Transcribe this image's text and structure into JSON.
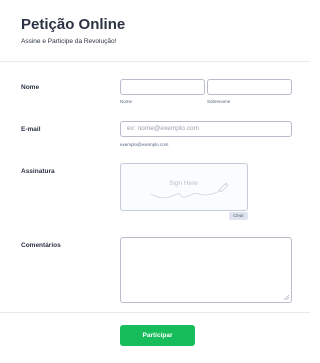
{
  "header": {
    "title": "Petição Online",
    "subtitle": "Assine e Participe da Revolução!"
  },
  "fields": {
    "name": {
      "label": "Nome",
      "first_value": "",
      "last_value": "",
      "first_sublabel": "Nome",
      "last_sublabel": "Sobrenome"
    },
    "email": {
      "label": "E-mail",
      "placeholder": "ex: nome@exemplo.com",
      "sublabel": "exemplo@exemplo.com"
    },
    "signature": {
      "label": "Assinatura",
      "hint": "Sign Here",
      "clear_label": "Clear"
    },
    "comments": {
      "label": "Comentários",
      "value": ""
    }
  },
  "submit": {
    "label": "Participar",
    "color": "#18bd5b"
  },
  "icons": {
    "signature_pen": "pen-icon",
    "resize_handle": "resize-handle-icon"
  }
}
